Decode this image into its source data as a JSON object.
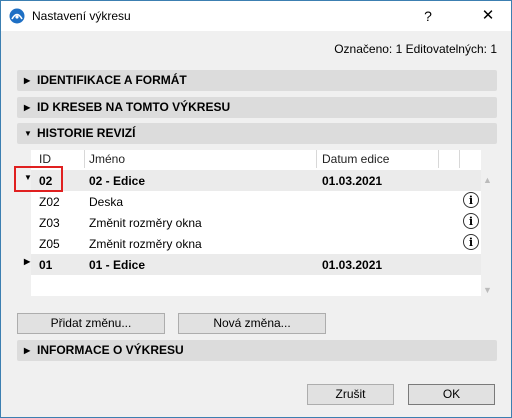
{
  "window": {
    "title": "Nastavení výkresu",
    "help_label": "?",
    "close_label": "✕"
  },
  "selection_info": "Označeno: 1 Editovatelných: 1",
  "sections": {
    "identification": "IDENTIFIKACE A FORMÁT",
    "drawing_ids": "ID KRESEB NA TOMTO VÝKRESU",
    "revision_history": "HISTORIE REVIZÍ",
    "drawing_info": "INFORMACE O VÝKRESU"
  },
  "revision_table": {
    "columns": [
      "ID",
      "Jméno",
      "Datum edice"
    ],
    "rows": [
      {
        "id": "02",
        "name": "02 - Edice",
        "date": "01.03.2021"
      },
      {
        "id": "Z02",
        "name": "Deska",
        "date": ""
      },
      {
        "id": "Z03",
        "name": "Změnit rozměry okna",
        "date": ""
      },
      {
        "id": "Z05",
        "name": "Změnit rozměry okna",
        "date": ""
      },
      {
        "id": "01",
        "name": "01 - Edice",
        "date": "01.03.2021"
      }
    ]
  },
  "buttons": {
    "add_change": "Přidat změnu...",
    "new_change": "Nová změna...",
    "cancel": "Zrušit",
    "ok": "OK"
  },
  "icons": {
    "app": "archicad-icon",
    "info": "info-icon",
    "expand": "triangle-right-icon",
    "collapse": "triangle-down-icon"
  }
}
